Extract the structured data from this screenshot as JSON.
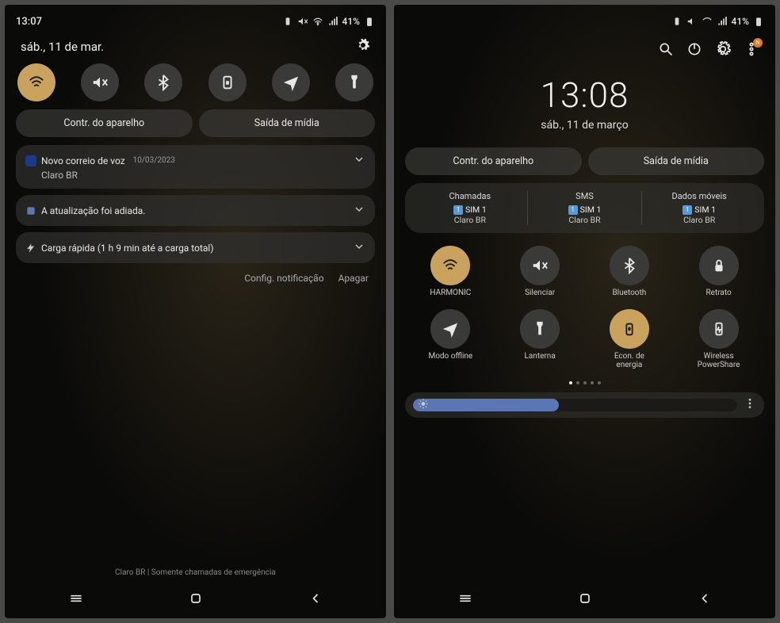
{
  "left": {
    "status": {
      "time": "13:07",
      "battery": "41%"
    },
    "date": "sáb., 11 de mar.",
    "controls": {
      "device_ctrl": "Contr. do aparelho",
      "media_output": "Saída de mídia"
    },
    "notifications": [
      {
        "title": "Novo correio de voz",
        "date": "10/03/2023",
        "subtitle": "Claro BR"
      },
      {
        "title": "A atualização foi adiada."
      },
      {
        "title": "Carga rápida (1 h 9 min até a carga total)"
      }
    ],
    "actions": {
      "settings": "Config. notificação",
      "clear": "Apagar"
    },
    "carrier": "Claro BR  |  Somente chamadas de emergência"
  },
  "right": {
    "status": {
      "battery": "41%"
    },
    "clock": "13:08",
    "date": "sáb., 11 de março",
    "controls": {
      "device_ctrl": "Contr. do aparelho",
      "media_output": "Saída de mídia"
    },
    "sim": {
      "calls": {
        "h": "Chamadas",
        "sim": "SIM 1",
        "carrier": "Claro BR"
      },
      "sms": {
        "h": "SMS",
        "sim": "SIM 1",
        "carrier": "Claro BR"
      },
      "data": {
        "h": "Dados móveis",
        "sim": "SIM 1",
        "carrier": "Claro BR"
      }
    },
    "tiles": [
      {
        "label": "HARMONIC",
        "state": "on",
        "icon": "wifi"
      },
      {
        "label": "Silenciar",
        "state": "off",
        "icon": "mute"
      },
      {
        "label": "Bluetooth",
        "state": "off",
        "icon": "bt"
      },
      {
        "label": "Retrato",
        "state": "off",
        "icon": "lock"
      },
      {
        "label": "Modo offline",
        "state": "off",
        "icon": "plane"
      },
      {
        "label": "Lanterna",
        "state": "off",
        "icon": "flash"
      },
      {
        "label": "Econ. de energia",
        "state": "on",
        "icon": "battery"
      },
      {
        "label": "Wireless PowerShare",
        "state": "off",
        "icon": "wshare"
      }
    ],
    "notification_badge": "N"
  }
}
